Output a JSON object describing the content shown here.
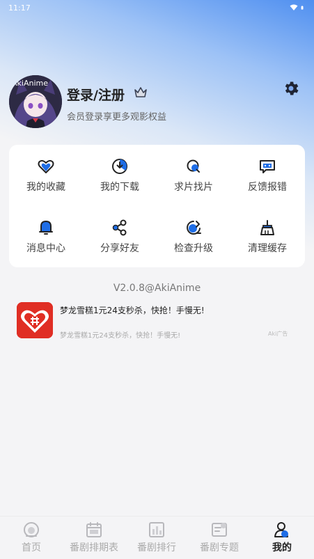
{
  "status_bar": {
    "time": "11:17"
  },
  "profile": {
    "title": "登录/注册",
    "subtitle": "会员登录享更多观影权益",
    "avatar_text": "AkiAnime"
  },
  "grid": {
    "items": [
      {
        "label": "我的收藏",
        "icon": "heart-icon"
      },
      {
        "label": "我的下载",
        "icon": "download-icon"
      },
      {
        "label": "求片找片",
        "icon": "search-film-icon"
      },
      {
        "label": "反馈报错",
        "icon": "feedback-icon"
      },
      {
        "label": "消息中心",
        "icon": "bell-icon"
      },
      {
        "label": "分享好友",
        "icon": "share-icon"
      },
      {
        "label": "检查升级",
        "icon": "upgrade-icon"
      },
      {
        "label": "清理缓存",
        "icon": "broom-icon"
      }
    ]
  },
  "version": "V2.0.8@AkiAnime",
  "ad": {
    "title": "梦龙雪糕1元24支秒杀，快抢！手慢无!",
    "description": "梦龙雪糕1元24支秒杀，快抢！手慢无!",
    "tag": "Aki广告"
  },
  "bottom_nav": {
    "items": [
      {
        "label": "首页",
        "icon": "home-icon"
      },
      {
        "label": "番剧排期表",
        "icon": "calendar-icon"
      },
      {
        "label": "番剧排行",
        "icon": "ranking-icon"
      },
      {
        "label": "番剧专题",
        "icon": "topic-icon"
      },
      {
        "label": "我的",
        "icon": "profile-icon",
        "active": true
      }
    ]
  },
  "colors": {
    "accent": "#1e6de6",
    "ad_brand": "#e02e24"
  }
}
